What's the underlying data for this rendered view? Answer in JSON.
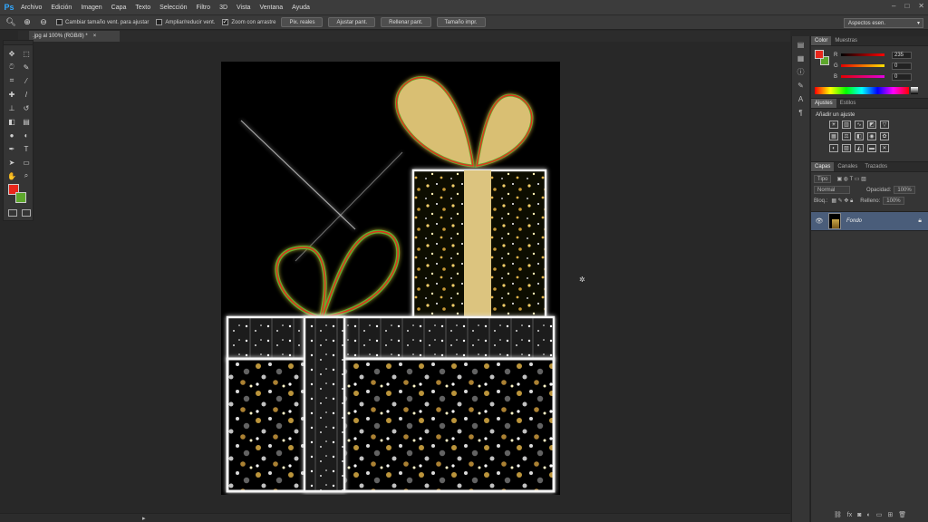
{
  "app": {
    "logo": "Ps"
  },
  "menu": [
    "Archivo",
    "Edición",
    "Imagen",
    "Capa",
    "Texto",
    "Selección",
    "Filtro",
    "3D",
    "Vista",
    "Ventana",
    "Ayuda"
  ],
  "options": {
    "check1": "Cambiar tamaño vent. para ajustar",
    "check2": "Ampliar/reducir vent.",
    "check3": "Zoom con arrastre",
    "btn1": "Pix. reales",
    "btn2": "Ajustar pant.",
    "btn3": "Rellenar pant.",
    "btn4": "Tamaño impr.",
    "workspace": "Aspectos esen."
  },
  "document": {
    "tab_title": ".jpg al 100% (RGB/8) *"
  },
  "color_panel": {
    "tab_active": "Color",
    "tab_other": "Muestras",
    "r_label": "R",
    "g_label": "G",
    "b_label": "B",
    "r_value": "235",
    "g_value": "0",
    "b_value": "0",
    "fg_color": "#e8261b",
    "bg_color": "#5da72c"
  },
  "adjustments": {
    "tab_active": "Ajustes",
    "tab_other": "Estilos",
    "title": "Añadir un ajuste"
  },
  "layers": {
    "tab_active": "Capas",
    "tab2": "Canales",
    "tab3": "Trazados",
    "kind": "Tipo",
    "blend_mode": "Normal",
    "opacity_label": "Opacidad:",
    "opacity_value": "100%",
    "lock_label": "Bloq.:",
    "fill_label": "Relleno:",
    "fill_value": "100%",
    "layer_name": "Fondo"
  }
}
